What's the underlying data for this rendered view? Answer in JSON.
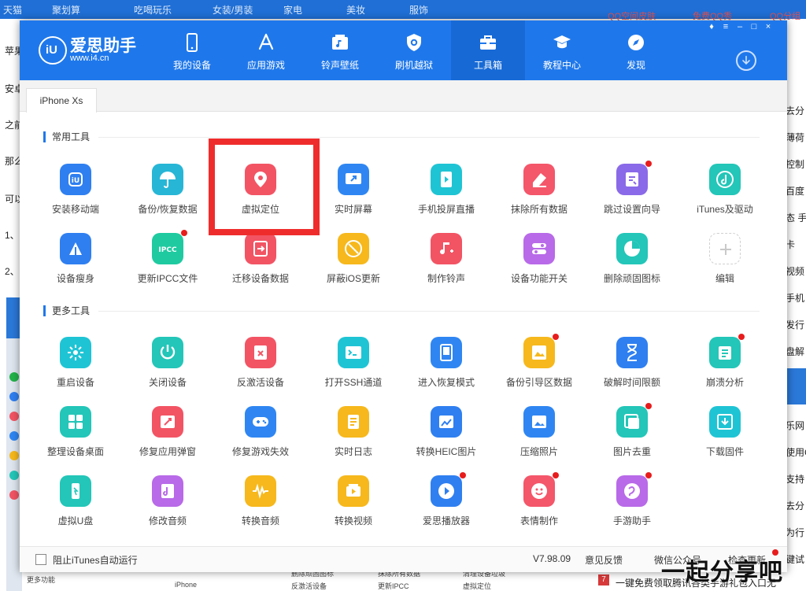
{
  "background": {
    "top_links": [
      "天猫",
      "聚划算",
      "吃喝玩乐",
      "女装/男装",
      "家电",
      "美妆",
      "服饰"
    ],
    "qq_links": [
      "QQ空间皮肤",
      "免费QQ秀",
      "QQ分组"
    ],
    "left_fragments": [
      "苹果",
      "安卓",
      "之前",
      "那么",
      "可以",
      "1、",
      "2、"
    ],
    "right_fragments": [
      "去分",
      "薄荷",
      "控制",
      "百度",
      "态 手",
      "卡",
      "视频",
      "手机",
      "发行",
      "盘解",
      "乐网",
      "使用C",
      "支持",
      "去分",
      "为行",
      "键试"
    ],
    "bottom_fragments": [
      "更多功能",
      "iPhone",
      "删除顽固图标",
      "抹除所有数据",
      "清理设备垃圾",
      "反激活设备",
      "更新IPCC",
      "虚拟定位"
    ],
    "bottom_badge": "7",
    "bottom_text": "一键免费领取腾讯各类手游礼包入口无",
    "watermark": "一起分享吧"
  },
  "app": {
    "logo_mark": "iU",
    "brand_name": "爱思助手",
    "brand_url": "www.i4.cn",
    "nav": [
      {
        "label": "我的设备",
        "icon": "phone-icon"
      },
      {
        "label": "应用游戏",
        "icon": "appstore-icon"
      },
      {
        "label": "铃声壁纸",
        "icon": "music-folder-icon"
      },
      {
        "label": "刷机越狱",
        "icon": "shield-icon"
      },
      {
        "label": "工具箱",
        "icon": "toolbox-icon",
        "active": true
      },
      {
        "label": "教程中心",
        "icon": "graduation-cap-icon"
      },
      {
        "label": "发现",
        "icon": "compass-icon"
      }
    ],
    "window_controls": [
      "skin",
      "menu",
      "minimize",
      "maximize",
      "close"
    ],
    "device_tab": "iPhone Xs",
    "sections": {
      "common": "常用工具",
      "more": "更多工具"
    },
    "common_tools": [
      {
        "label": "安装移动端",
        "color": "#2f7ff0",
        "dot": false
      },
      {
        "label": "备份/恢复数据",
        "color": "#27b6d6",
        "dot": false
      },
      {
        "label": "虚拟定位",
        "color": "#f25464",
        "dot": false
      },
      {
        "label": "实时屏幕",
        "color": "#2f86f2",
        "dot": false
      },
      {
        "label": "手机投屏直播",
        "color": "#1fc4d4",
        "dot": false
      },
      {
        "label": "抹除所有数据",
        "color": "#f4566a",
        "dot": false
      },
      {
        "label": "跳过设置向导",
        "color": "#8a6ae8",
        "dot": true
      },
      {
        "label": "iTunes及驱动",
        "color": "#23c6b8",
        "dot": false
      },
      {
        "label": "设备瘦身",
        "color": "#2f7ff0",
        "dot": false
      },
      {
        "label": "更新IPCC文件",
        "color": "#1fcaa0",
        "dot": true
      },
      {
        "label": "迁移设备数据",
        "color": "#f25464",
        "dot": false
      },
      {
        "label": "屏蔽iOS更新",
        "color": "#f6b81c",
        "dot": false
      },
      {
        "label": "制作铃声",
        "color": "#f25464",
        "dot": false
      },
      {
        "label": "设备功能开关",
        "color": "#b86ae8",
        "dot": false
      },
      {
        "label": "删除顽固图标",
        "color": "#23c6b8",
        "dot": false
      },
      {
        "label": "编辑",
        "color": "#ffffff",
        "dot": false
      }
    ],
    "more_tools": [
      {
        "label": "重启设备",
        "color": "#1fc4d4",
        "dot": false
      },
      {
        "label": "关闭设备",
        "color": "#23c6b8",
        "dot": false
      },
      {
        "label": "反激活设备",
        "color": "#f25464",
        "dot": false
      },
      {
        "label": "打开SSH通道",
        "color": "#1fc4d4",
        "dot": false
      },
      {
        "label": "进入恢复模式",
        "color": "#2f86f2",
        "dot": false
      },
      {
        "label": "备份引导区数据",
        "color": "#f6b81c",
        "dot": true
      },
      {
        "label": "破解时间限额",
        "color": "#2f7ff0",
        "dot": false
      },
      {
        "label": "崩溃分析",
        "color": "#23c6b8",
        "dot": true
      },
      {
        "label": "整理设备桌面",
        "color": "#23c6b8",
        "dot": false
      },
      {
        "label": "修复应用弹窗",
        "color": "#f25464",
        "dot": false
      },
      {
        "label": "修复游戏失效",
        "color": "#2f86f2",
        "dot": false
      },
      {
        "label": "实时日志",
        "color": "#f6b81c",
        "dot": false
      },
      {
        "label": "转换HEIC图片",
        "color": "#2f7ff0",
        "dot": false
      },
      {
        "label": "压缩照片",
        "color": "#2f86f2",
        "dot": false
      },
      {
        "label": "图片去重",
        "color": "#23c6b8",
        "dot": true
      },
      {
        "label": "下载固件",
        "color": "#1fc4d4",
        "dot": false
      },
      {
        "label": "虚拟U盘",
        "color": "#23c6b8",
        "dot": false
      },
      {
        "label": "修改音频",
        "color": "#b86ae8",
        "dot": false
      },
      {
        "label": "转换音频",
        "color": "#f6b81c",
        "dot": false
      },
      {
        "label": "转换视频",
        "color": "#f6b81c",
        "dot": false
      },
      {
        "label": "爱思播放器",
        "color": "#2f7ff0",
        "dot": true
      },
      {
        "label": "表情制作",
        "color": "#f4566a",
        "dot": true
      },
      {
        "label": "手游助手",
        "color": "#b86ae8",
        "dot": true
      }
    ],
    "footer": {
      "block_itunes": "阻止iTunes自动运行",
      "version": "V7.98.09",
      "feedback": "意见反馈",
      "wechat": "微信公众号",
      "check_update": "检查更新"
    }
  }
}
